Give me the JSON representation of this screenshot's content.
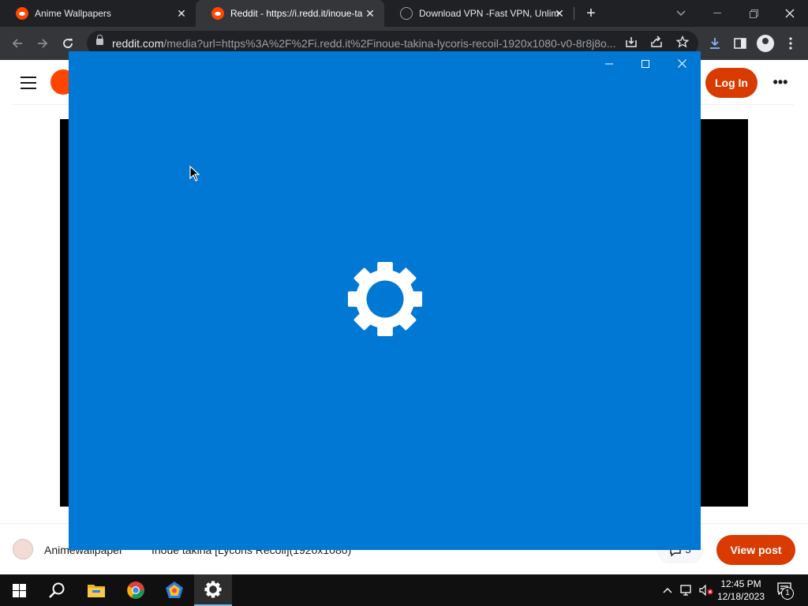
{
  "browser": {
    "tabs": [
      {
        "title": "Anime Wallpapers",
        "favicon": "reddit-icon",
        "active": false
      },
      {
        "title": "Reddit - https://i.redd.it/inoue-ta",
        "favicon": "reddit-icon",
        "active": true
      },
      {
        "title": "Download VPN -Fast VPN, Unlim",
        "favicon": "globe-icon",
        "active": false
      }
    ],
    "close_glyph": "✕",
    "new_tab_glyph": "+",
    "url_host": "reddit.com",
    "url_rest": "/media?url=https%3A%2F%2Fi.redd.it%2Finoue-takina-lycoris-recoil-1920x1080-v0-8r8j8o...",
    "accent": "#8ab4f8"
  },
  "page": {
    "login_label": "Log In",
    "more_glyph": "•••",
    "username": "Animewallpaper",
    "post_title": "Inoue takina [Lycoris Recoil](1920x1080)",
    "comment_count": "5",
    "view_post_label": "View post",
    "brand_color": "#d93a00"
  },
  "splash": {
    "background": "#0078d4",
    "icon": "settings-gear-icon",
    "minimize_glyph": "—",
    "maximize_glyph": "☐",
    "close_glyph": "✕"
  },
  "taskbar": {
    "time": "12:45 PM",
    "date": "12/18/2023",
    "notification_count": "1",
    "pinned": [
      "start-icon",
      "search-icon",
      "file-explorer-icon",
      "chrome-icon",
      "app-icon",
      "settings-icon"
    ]
  }
}
